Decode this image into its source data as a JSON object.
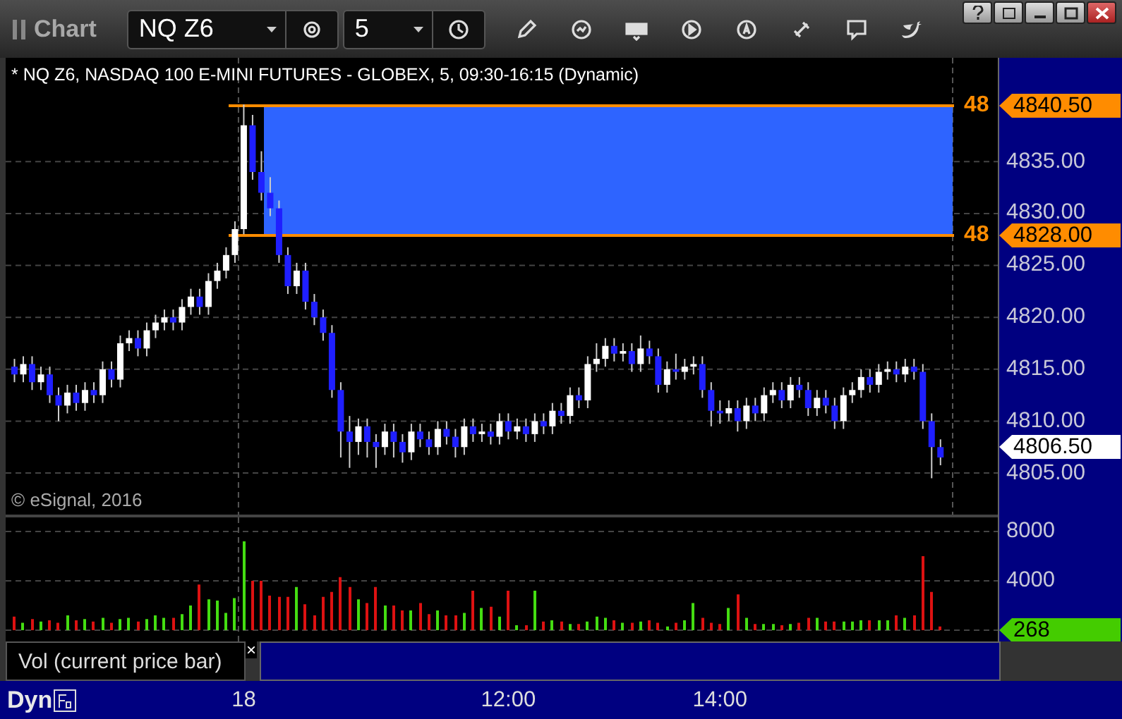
{
  "toolbar": {
    "title": "Chart",
    "symbol": "NQ Z6",
    "interval": "5"
  },
  "chart": {
    "header": "* NQ Z6, NASDAQ 100 E-MINI FUTURES - GLOBEX, 5, 09:30-16:15 (Dynamic)",
    "copyright": "© eSignal, 2016",
    "markers": [
      {
        "kind": "level",
        "label": "4840.50",
        "line_label": "48"
      },
      {
        "kind": "level",
        "label": "4828.00",
        "line_label": "48"
      },
      {
        "kind": "last",
        "label": "4806.50"
      }
    ],
    "chart_data": {
      "type": "candlestick",
      "grid": true,
      "ylim": [
        4801,
        4845
      ],
      "yticks": [
        {
          "value": 4835,
          "label": "4835.00"
        },
        {
          "value": 4830,
          "label": "4830.00"
        },
        {
          "value": 4825,
          "label": "4825.00"
        },
        {
          "value": 4820,
          "label": "4820.00"
        },
        {
          "value": 4815,
          "label": "4815.00"
        },
        {
          "value": 4810,
          "label": "4810.00"
        },
        {
          "value": 4805,
          "label": "4805.00"
        }
      ],
      "categories": [
        null,
        null,
        null,
        null,
        null,
        null,
        null,
        null,
        null,
        null,
        null,
        null,
        null,
        null,
        null,
        null,
        null,
        null,
        null,
        null,
        null,
        null,
        null,
        null,
        null,
        null,
        null,
        null,
        null,
        null,
        null,
        null,
        null,
        null,
        null,
        null,
        null,
        null,
        null,
        null,
        null,
        null,
        null,
        null,
        null,
        null,
        null,
        null,
        null,
        null,
        null,
        null,
        null,
        null,
        null,
        null,
        null,
        null,
        null,
        null,
        null,
        null,
        null,
        null,
        null,
        null,
        null,
        null,
        null,
        null,
        null,
        null,
        null,
        null,
        null,
        null,
        null,
        null,
        null,
        null,
        null,
        null,
        null,
        null,
        null,
        null,
        null,
        null,
        null,
        null,
        null,
        null,
        null,
        null,
        null,
        null,
        null,
        null,
        null,
        null,
        null,
        null,
        null,
        null,
        null,
        null
      ],
      "ohlc": [
        [
          4815.25,
          4816,
          4813.75,
          4814.5
        ],
        [
          4814.5,
          4816.25,
          4813.75,
          4815.5
        ],
        [
          4815.5,
          4816.25,
          4813,
          4813.75
        ],
        [
          4813.75,
          4815.25,
          4813,
          4814.5
        ],
        [
          4814.5,
          4815.25,
          4811.75,
          4812.5
        ],
        [
          4812.5,
          4813.25,
          4810,
          4811.5
        ],
        [
          4811.5,
          4813.5,
          4810.75,
          4812.75
        ],
        [
          4812.75,
          4813.5,
          4811,
          4811.75
        ],
        [
          4811.75,
          4813.75,
          4811,
          4813
        ],
        [
          4813,
          4813.75,
          4811.75,
          4812.5
        ],
        [
          4812.5,
          4815.75,
          4811.75,
          4815
        ],
        [
          4815,
          4815.75,
          4813.25,
          4814
        ],
        [
          4814,
          4818.25,
          4813.25,
          4817.5
        ],
        [
          4817.5,
          4818.75,
          4816.75,
          4818
        ],
        [
          4818,
          4818.75,
          4816.25,
          4817
        ],
        [
          4817,
          4819.5,
          4816.25,
          4818.75
        ],
        [
          4818.75,
          4820.25,
          4818,
          4819.5
        ],
        [
          4819.5,
          4820.75,
          4818.75,
          4820
        ],
        [
          4820,
          4820.75,
          4818.75,
          4819.5
        ],
        [
          4819.5,
          4821.75,
          4818.75,
          4821
        ],
        [
          4821,
          4822.75,
          4820.25,
          4822
        ],
        [
          4822,
          4822.75,
          4820.25,
          4821
        ],
        [
          4821,
          4824.25,
          4820.25,
          4823.5
        ],
        [
          4823.5,
          4825.25,
          4822.75,
          4824.5
        ],
        [
          4824.5,
          4826.75,
          4823.75,
          4826
        ],
        [
          4826,
          4829.25,
          4825.25,
          4828.5
        ],
        [
          4828.5,
          4840.5,
          4828,
          4838.5
        ],
        [
          4838.5,
          4839.5,
          4833.25,
          4834
        ],
        [
          4834,
          4836,
          4831.25,
          4832
        ],
        [
          4832,
          4833.5,
          4829.75,
          4830.5
        ],
        [
          4830.5,
          4831.25,
          4825.25,
          4826
        ],
        [
          4826,
          4826.75,
          4822.25,
          4823
        ],
        [
          4823,
          4825.25,
          4822.25,
          4824.5
        ],
        [
          4824.5,
          4825.25,
          4820.75,
          4821.5
        ],
        [
          4821.5,
          4822.25,
          4819.25,
          4820
        ],
        [
          4820,
          4820.75,
          4817.75,
          4818.5
        ],
        [
          4818.5,
          4819.25,
          4812.25,
          4813
        ],
        [
          4813,
          4813.75,
          4806.5,
          4809
        ],
        [
          4809,
          4810.5,
          4805.5,
          4808
        ],
        [
          4808,
          4810.25,
          4806.75,
          4809.5
        ],
        [
          4809.5,
          4810.25,
          4806.5,
          4808
        ],
        [
          4808,
          4808.75,
          4805.5,
          4807.5
        ],
        [
          4807.5,
          4809.75,
          4806.75,
          4809
        ],
        [
          4809,
          4809.75,
          4806.5,
          4808
        ],
        [
          4808,
          4808.75,
          4806,
          4807
        ],
        [
          4807,
          4809.75,
          4806.25,
          4809
        ],
        [
          4809,
          4809.75,
          4807.5,
          4808.25
        ],
        [
          4808.25,
          4809,
          4806.75,
          4807.5
        ],
        [
          4807.5,
          4810,
          4806.75,
          4809.25
        ],
        [
          4809.25,
          4810,
          4807.75,
          4808.5
        ],
        [
          4808.5,
          4809.25,
          4806.5,
          4807.5
        ],
        [
          4807.5,
          4810.25,
          4806.75,
          4809.5
        ],
        [
          4809.5,
          4810.25,
          4808,
          4808.75
        ],
        [
          4808.75,
          4809.75,
          4808,
          4809
        ],
        [
          4809,
          4809.75,
          4807.75,
          4808.5
        ],
        [
          4808.5,
          4810.75,
          4807.75,
          4810
        ],
        [
          4810,
          4810.75,
          4808.25,
          4809
        ],
        [
          4809,
          4810.25,
          4808.25,
          4809.5
        ],
        [
          4809.5,
          4810.25,
          4808,
          4808.75
        ],
        [
          4808.75,
          4810.75,
          4808,
          4810
        ],
        [
          4810,
          4810.75,
          4808.75,
          4809.5
        ],
        [
          4809.5,
          4811.75,
          4808.75,
          4811
        ],
        [
          4811,
          4811.75,
          4809.75,
          4810.5
        ],
        [
          4810.5,
          4813.25,
          4809.75,
          4812.5
        ],
        [
          4812.5,
          4813.25,
          4811.25,
          4812
        ],
        [
          4812,
          4816.25,
          4811.25,
          4815.5
        ],
        [
          4815.5,
          4817.5,
          4814.75,
          4816
        ],
        [
          4816,
          4818,
          4815.25,
          4817.25
        ],
        [
          4817.25,
          4818,
          4815.75,
          4816.5
        ],
        [
          4816.5,
          4817.5,
          4815.75,
          4816.75
        ],
        [
          4816.75,
          4817.5,
          4814.75,
          4815.5
        ],
        [
          4815.5,
          4818.25,
          4814.75,
          4817
        ],
        [
          4817,
          4817.75,
          4815.5,
          4816.25
        ],
        [
          4816.25,
          4817,
          4812.75,
          4813.5
        ],
        [
          4813.5,
          4815.75,
          4812.75,
          4815
        ],
        [
          4815,
          4816.5,
          4814,
          4814.75
        ],
        [
          4814.75,
          4816,
          4814,
          4815.25
        ],
        [
          4815.25,
          4816.25,
          4814.5,
          4815.5
        ],
        [
          4815.5,
          4816.25,
          4812.25,
          4813
        ],
        [
          4813,
          4813.75,
          4809.5,
          4811
        ],
        [
          4811,
          4812,
          4809.75,
          4810.75
        ],
        [
          4810.75,
          4812,
          4810,
          4811.25
        ],
        [
          4811.25,
          4812,
          4809,
          4810
        ],
        [
          4810,
          4812.25,
          4809.25,
          4811.5
        ],
        [
          4811.5,
          4812.25,
          4810,
          4810.75
        ],
        [
          4810.75,
          4813.25,
          4810,
          4812.5
        ],
        [
          4812.5,
          4813.75,
          4811.75,
          4813
        ],
        [
          4813,
          4813.75,
          4811.25,
          4812
        ],
        [
          4812,
          4814.25,
          4811.25,
          4813.5
        ],
        [
          4813.5,
          4814.25,
          4812.25,
          4813
        ],
        [
          4813,
          4813.75,
          4810.5,
          4811.25
        ],
        [
          4811.25,
          4813,
          4810.5,
          4812.25
        ],
        [
          4812.25,
          4813,
          4810.75,
          4811.5
        ],
        [
          4811.5,
          4812.25,
          4809.25,
          4810
        ],
        [
          4810,
          4813.25,
          4809.25,
          4812.5
        ],
        [
          4812.5,
          4813.75,
          4811.75,
          4813
        ],
        [
          4813,
          4815,
          4812.25,
          4814.25
        ],
        [
          4814.25,
          4815,
          4812.75,
          4813.5
        ],
        [
          4813.5,
          4815.5,
          4812.75,
          4814.75
        ],
        [
          4814.75,
          4815.75,
          4814,
          4815
        ],
        [
          4815,
          4815.75,
          4813.75,
          4814.5
        ],
        [
          4814.5,
          4816,
          4813.75,
          4815.25
        ],
        [
          4815.25,
          4816,
          4814,
          4814.75
        ],
        [
          4814.75,
          4815.5,
          4809.25,
          4810
        ],
        [
          4810,
          4810.75,
          4804.5,
          4807.5
        ],
        [
          4807.5,
          4808.25,
          4805.75,
          4806.5
        ]
      ]
    }
  },
  "volume": {
    "current": "268",
    "chart_data": {
      "type": "bar",
      "grid": true,
      "ylim": [
        0,
        9140
      ],
      "yticks": [
        {
          "value": 8000,
          "label": "8000"
        },
        {
          "value": 4000,
          "label": "4000"
        }
      ],
      "categories": [
        null,
        null,
        null,
        null,
        null,
        null,
        null,
        null,
        null,
        null,
        null,
        null,
        null,
        null,
        null,
        null,
        null,
        null,
        null,
        null,
        null,
        null,
        null,
        null,
        null,
        null,
        "18",
        null,
        null,
        null,
        null,
        null,
        null,
        null,
        null,
        null,
        null,
        null,
        null,
        null,
        null,
        null,
        null,
        null,
        null,
        null,
        null,
        null,
        null,
        null,
        null,
        null,
        null,
        null,
        null,
        null,
        "12:00",
        null,
        null,
        null,
        null,
        null,
        null,
        null,
        null,
        null,
        null,
        null,
        null,
        null,
        null,
        null,
        null,
        null,
        null,
        null,
        null,
        null,
        null,
        null,
        "14:00",
        null,
        null,
        null,
        null,
        null,
        null,
        null,
        null,
        null,
        null,
        null,
        null,
        null,
        null,
        null,
        null,
        null,
        null,
        null,
        null,
        null,
        null,
        null,
        null,
        null
      ],
      "values": [
        1100,
        600,
        900,
        700,
        800,
        600,
        1200,
        800,
        900,
        700,
        1000,
        600,
        900,
        1000,
        700,
        900,
        1200,
        1000,
        1000,
        1300,
        2000,
        3700,
        2500,
        2400,
        1400,
        2600,
        7200,
        4000,
        4000,
        2800,
        2700,
        2700,
        3500,
        2100,
        1200,
        2700,
        3100,
        4300,
        3500,
        2500,
        2200,
        3500,
        2000,
        2000,
        1600,
        1600,
        2200,
        1300,
        1600,
        1200,
        1200,
        1400,
        3200,
        1800,
        1900,
        1100,
        3200,
        400,
        400,
        3200,
        700,
        800,
        700,
        500,
        500,
        700,
        1100,
        1000,
        800,
        600,
        600,
        700,
        800,
        600,
        300,
        600,
        800,
        2200,
        1000,
        600,
        500,
        1800,
        2900,
        1000,
        500,
        500,
        500,
        400,
        500,
        600,
        1000,
        1000,
        700,
        700,
        700,
        700,
        800,
        800,
        800,
        800,
        1200,
        1000,
        1200,
        6000,
        3100,
        300
      ]
    },
    "legend": "Vol (current price bar)",
    "close": "×"
  },
  "x_axis": {
    "mode": "Dyn"
  }
}
